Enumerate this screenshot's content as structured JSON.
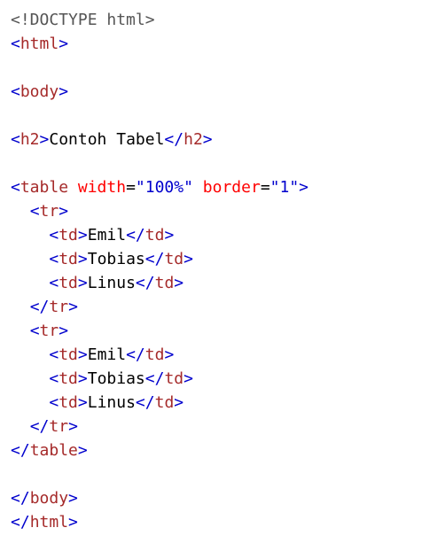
{
  "code": {
    "lines": [
      [
        {
          "t": "<!DOCTYPE html>",
          "c": "doctype"
        }
      ],
      [
        {
          "t": "<",
          "c": "bracket"
        },
        {
          "t": "html",
          "c": "tag"
        },
        {
          "t": ">",
          "c": "bracket"
        }
      ],
      [],
      [
        {
          "t": "<",
          "c": "bracket"
        },
        {
          "t": "body",
          "c": "tag"
        },
        {
          "t": ">",
          "c": "bracket"
        }
      ],
      [],
      [
        {
          "t": "<",
          "c": "bracket"
        },
        {
          "t": "h2",
          "c": "tag"
        },
        {
          "t": ">",
          "c": "bracket"
        },
        {
          "t": "Contoh Tabel",
          "c": "text"
        },
        {
          "t": "</",
          "c": "bracket"
        },
        {
          "t": "h2",
          "c": "tag"
        },
        {
          "t": ">",
          "c": "bracket"
        }
      ],
      [],
      [
        {
          "t": "<",
          "c": "bracket"
        },
        {
          "t": "table",
          "c": "tag"
        },
        {
          "t": " ",
          "c": "text"
        },
        {
          "t": "width",
          "c": "attr"
        },
        {
          "t": "=",
          "c": "op"
        },
        {
          "t": "\"100%\"",
          "c": "value"
        },
        {
          "t": " ",
          "c": "text"
        },
        {
          "t": "border",
          "c": "attr"
        },
        {
          "t": "=",
          "c": "op"
        },
        {
          "t": "\"1\"",
          "c": "value"
        },
        {
          "t": ">",
          "c": "bracket"
        }
      ],
      [
        {
          "t": "  ",
          "c": "text"
        },
        {
          "t": "<",
          "c": "bracket"
        },
        {
          "t": "tr",
          "c": "tag"
        },
        {
          "t": ">",
          "c": "bracket"
        }
      ],
      [
        {
          "t": "    ",
          "c": "text"
        },
        {
          "t": "<",
          "c": "bracket"
        },
        {
          "t": "td",
          "c": "tag"
        },
        {
          "t": ">",
          "c": "bracket"
        },
        {
          "t": "Emil",
          "c": "text"
        },
        {
          "t": "</",
          "c": "bracket"
        },
        {
          "t": "td",
          "c": "tag"
        },
        {
          "t": ">",
          "c": "bracket"
        }
      ],
      [
        {
          "t": "    ",
          "c": "text"
        },
        {
          "t": "<",
          "c": "bracket"
        },
        {
          "t": "td",
          "c": "tag"
        },
        {
          "t": ">",
          "c": "bracket"
        },
        {
          "t": "Tobias",
          "c": "text"
        },
        {
          "t": "</",
          "c": "bracket"
        },
        {
          "t": "td",
          "c": "tag"
        },
        {
          "t": ">",
          "c": "bracket"
        }
      ],
      [
        {
          "t": "    ",
          "c": "text"
        },
        {
          "t": "<",
          "c": "bracket"
        },
        {
          "t": "td",
          "c": "tag"
        },
        {
          "t": ">",
          "c": "bracket"
        },
        {
          "t": "Linus",
          "c": "text"
        },
        {
          "t": "</",
          "c": "bracket"
        },
        {
          "t": "td",
          "c": "tag"
        },
        {
          "t": ">",
          "c": "bracket"
        }
      ],
      [
        {
          "t": "  ",
          "c": "text"
        },
        {
          "t": "</",
          "c": "bracket"
        },
        {
          "t": "tr",
          "c": "tag"
        },
        {
          "t": ">",
          "c": "bracket"
        }
      ],
      [
        {
          "t": "  ",
          "c": "text"
        },
        {
          "t": "<",
          "c": "bracket"
        },
        {
          "t": "tr",
          "c": "tag"
        },
        {
          "t": ">",
          "c": "bracket"
        }
      ],
      [
        {
          "t": "    ",
          "c": "text"
        },
        {
          "t": "<",
          "c": "bracket"
        },
        {
          "t": "td",
          "c": "tag"
        },
        {
          "t": ">",
          "c": "bracket"
        },
        {
          "t": "Emil",
          "c": "text"
        },
        {
          "t": "</",
          "c": "bracket"
        },
        {
          "t": "td",
          "c": "tag"
        },
        {
          "t": ">",
          "c": "bracket"
        }
      ],
      [
        {
          "t": "    ",
          "c": "text"
        },
        {
          "t": "<",
          "c": "bracket"
        },
        {
          "t": "td",
          "c": "tag"
        },
        {
          "t": ">",
          "c": "bracket"
        },
        {
          "t": "Tobias",
          "c": "text"
        },
        {
          "t": "</",
          "c": "bracket"
        },
        {
          "t": "td",
          "c": "tag"
        },
        {
          "t": ">",
          "c": "bracket"
        }
      ],
      [
        {
          "t": "    ",
          "c": "text"
        },
        {
          "t": "<",
          "c": "bracket"
        },
        {
          "t": "td",
          "c": "tag"
        },
        {
          "t": ">",
          "c": "bracket"
        },
        {
          "t": "Linus",
          "c": "text"
        },
        {
          "t": "</",
          "c": "bracket"
        },
        {
          "t": "td",
          "c": "tag"
        },
        {
          "t": ">",
          "c": "bracket"
        }
      ],
      [
        {
          "t": "  ",
          "c": "text"
        },
        {
          "t": "</",
          "c": "bracket"
        },
        {
          "t": "tr",
          "c": "tag"
        },
        {
          "t": ">",
          "c": "bracket"
        }
      ],
      [
        {
          "t": "</",
          "c": "bracket"
        },
        {
          "t": "table",
          "c": "tag"
        },
        {
          "t": ">",
          "c": "bracket"
        }
      ],
      [],
      [
        {
          "t": "</",
          "c": "bracket"
        },
        {
          "t": "body",
          "c": "tag"
        },
        {
          "t": ">",
          "c": "bracket"
        }
      ],
      [
        {
          "t": "</",
          "c": "bracket"
        },
        {
          "t": "html",
          "c": "tag"
        },
        {
          "t": ">",
          "c": "bracket"
        }
      ]
    ]
  },
  "colors": {
    "background": "#ffffff",
    "doctype": "#555555",
    "bracket": "#0000cd",
    "tag": "#a52a2a",
    "attr": "#ff0000",
    "value": "#0000cd",
    "text": "#000000"
  }
}
